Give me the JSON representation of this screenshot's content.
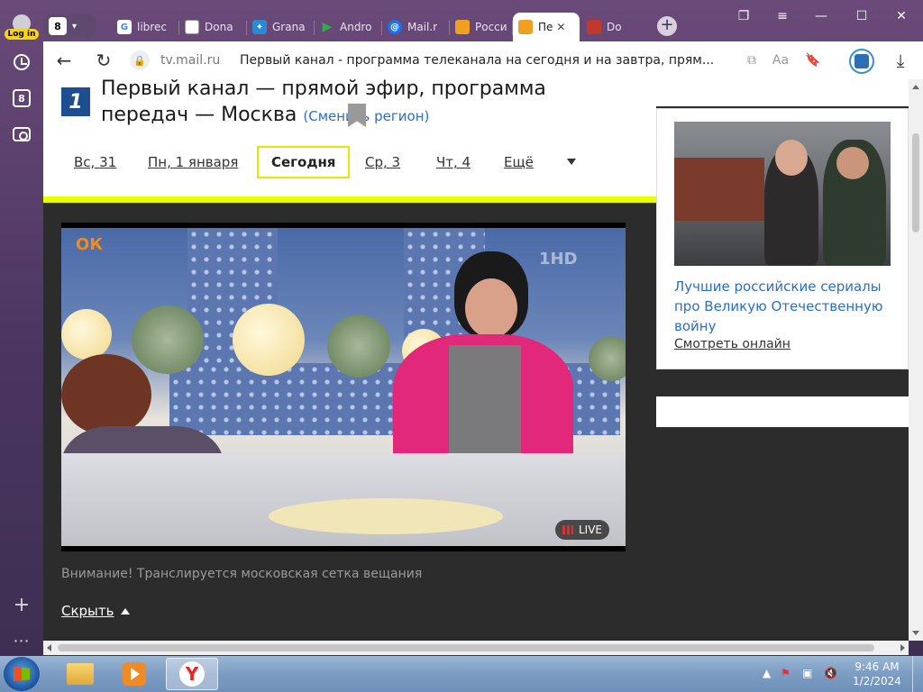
{
  "sidebar": {
    "login_label": "Log in",
    "eight_badge": "8",
    "add_glyph": "+",
    "more_glyph": "⋯"
  },
  "tabs": {
    "count": "8",
    "items": [
      {
        "label": "librec",
        "icon": "google-icon",
        "color": "#ffffff"
      },
      {
        "label": "Dona",
        "icon": "document-icon",
        "color": "#ffffff"
      },
      {
        "label": "Grana",
        "icon": "grana-icon",
        "color": "#2a8ad4"
      },
      {
        "label": "Andro",
        "icon": "play-store-icon",
        "color": "#34a853"
      },
      {
        "label": "Mail.r",
        "icon": "mail-icon",
        "color": "#1a73e8"
      },
      {
        "label": "Росси",
        "icon": "tv-icon",
        "color": "#f0a020"
      },
      {
        "label": "Пе",
        "icon": "tv-icon",
        "color": "#f0a020",
        "active": true
      },
      {
        "label": "Do",
        "icon": "shield-icon",
        "color": "#c0392b"
      }
    ],
    "close_glyph": "✕",
    "new_tab_glyph": "+"
  },
  "window": {
    "minimize": "—",
    "maximize": "☐",
    "close": "✕",
    "collections": "❐",
    "menu": "≡"
  },
  "toolbar": {
    "back": "←",
    "reload": "↻",
    "url": "tv.mail.ru",
    "title": "Первый канал - программа телеканала на сегодня и на завтра, прям...",
    "download": "⤓"
  },
  "page": {
    "logo_text": "1",
    "heading": "Первый канал — прямой эфир, программа передач — Москва",
    "change_region": "(Сменить регион)",
    "days": [
      {
        "label": "Вс, 31"
      },
      {
        "label": "Пн, 1 января"
      },
      {
        "label": "Сегодня",
        "selected": true
      },
      {
        "label": "Ср, 3"
      },
      {
        "label": "Чт, 4"
      },
      {
        "label": "Ещё"
      }
    ],
    "live_label": "LIVE",
    "ok_logo": "ОК",
    "hd_logo": "1HD",
    "notice": "Внимание! Транслируется московская сетка вещания",
    "hide_label": "Скрыть",
    "promo": {
      "title": "Лучшие российские сериалы про Великую Отечественную войну",
      "link": "Смотреть онлайн"
    }
  },
  "taskbar": {
    "time": "9:46 AM",
    "date": "1/2/2024",
    "apps": [
      {
        "name": "file-explorer"
      },
      {
        "name": "media-player"
      },
      {
        "name": "yandex-browser",
        "active": true
      }
    ]
  },
  "colors": {
    "accent_yellow": "#e8ff00",
    "link_blue": "#2a6ec6",
    "channel_blue": "#1d4e8f"
  }
}
